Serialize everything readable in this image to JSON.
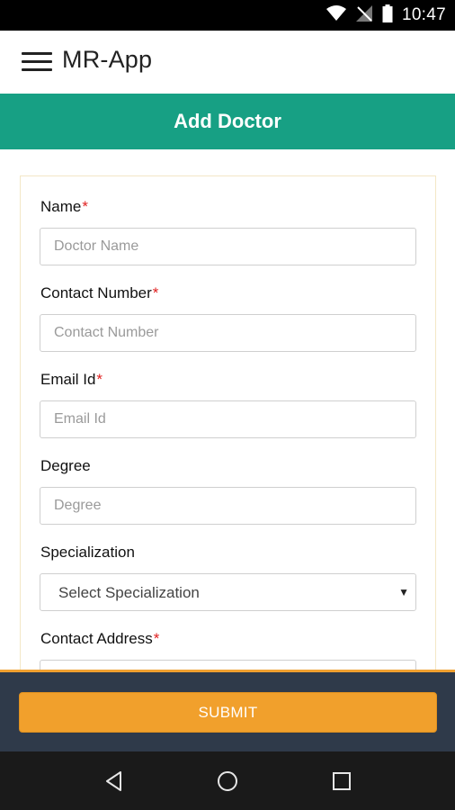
{
  "status_bar": {
    "time": "10:47",
    "icons": [
      "wifi-icon",
      "no-signal-icon",
      "battery-icon"
    ]
  },
  "app_bar": {
    "title": "MR-App",
    "menu_icon": "menu-icon"
  },
  "banner": {
    "title": "Add Doctor"
  },
  "form": {
    "required_marker": "*",
    "fields": [
      {
        "label": "Name",
        "required": true,
        "placeholder": "Doctor Name"
      },
      {
        "label": "Contact Number",
        "required": true,
        "placeholder": "Contact Number"
      },
      {
        "label": "Email Id",
        "required": true,
        "placeholder": "Email Id"
      },
      {
        "label": "Degree",
        "required": false,
        "placeholder": "Degree"
      },
      {
        "label": "Specialization",
        "required": false,
        "selected": "Select Specialization"
      },
      {
        "label": "Contact Address",
        "required": true,
        "placeholder": ""
      }
    ]
  },
  "submit": {
    "label": "SUBMIT"
  },
  "nav_bar": {
    "buttons": [
      "back-icon",
      "home-icon",
      "recents-icon"
    ]
  },
  "colors": {
    "banner": "#17a084",
    "submit": "#f1a02c",
    "submit_bar": "#2f3a4a",
    "required": "#e02020"
  }
}
